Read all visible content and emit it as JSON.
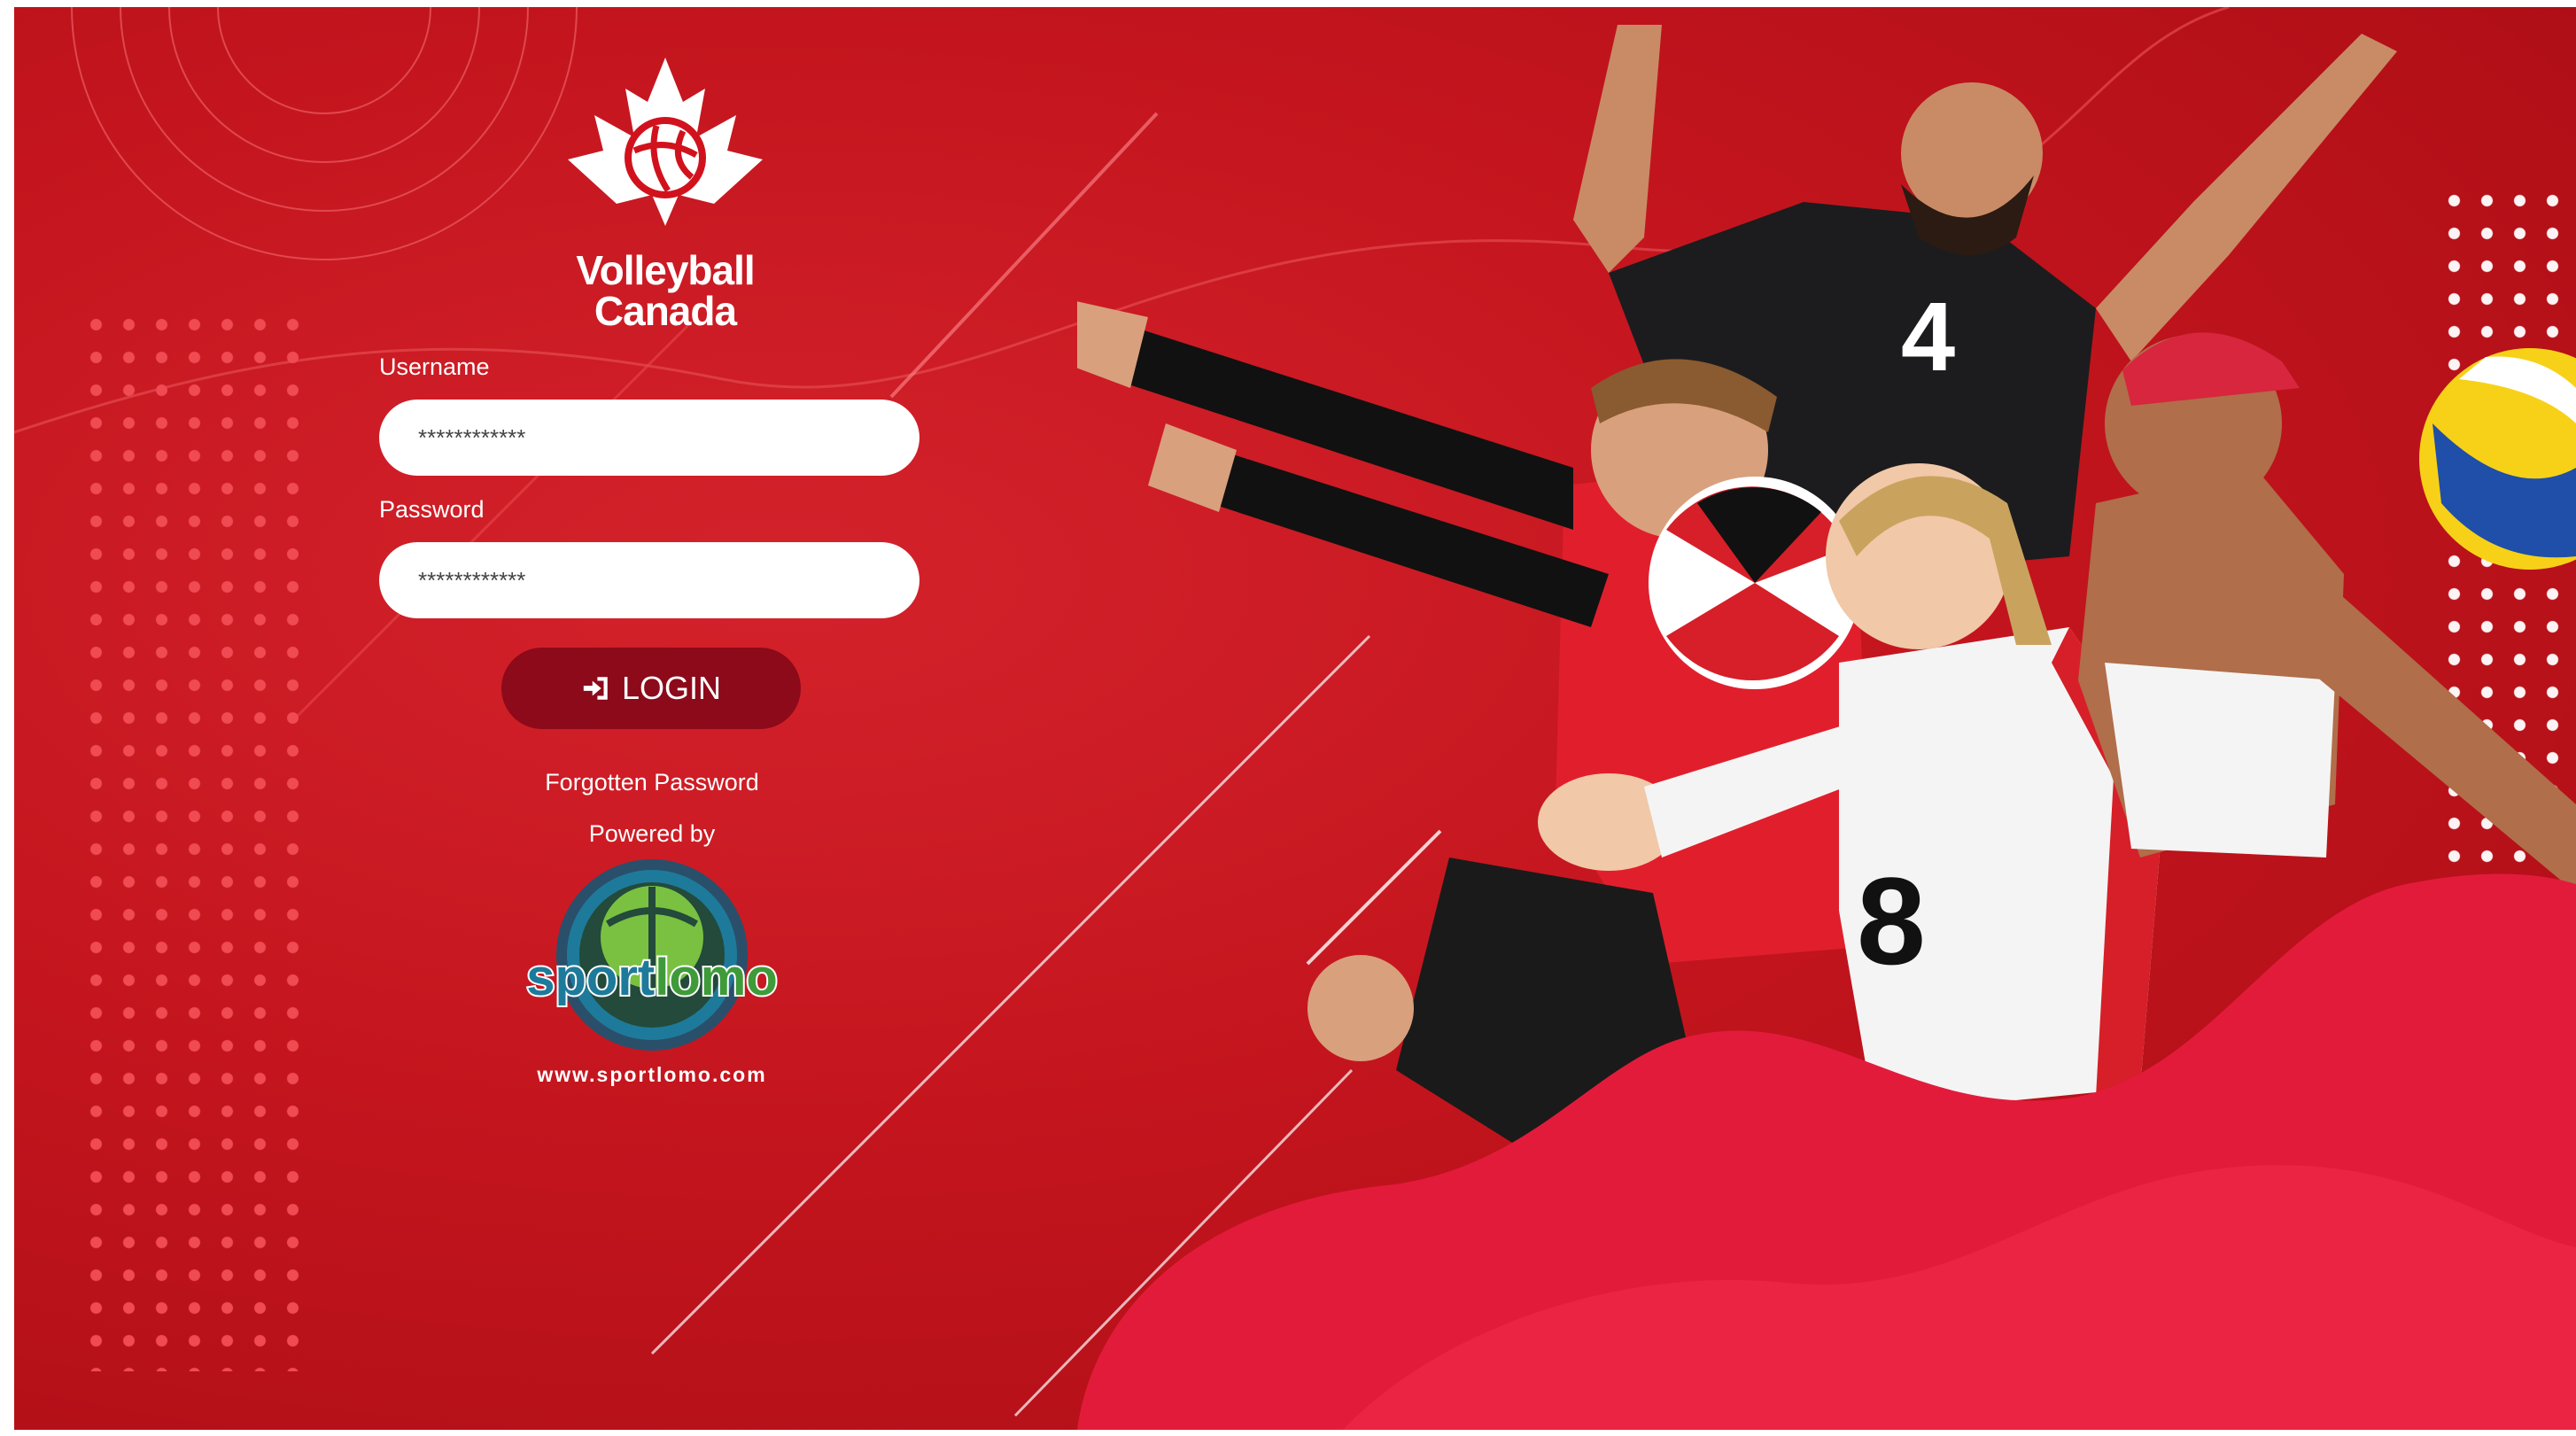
{
  "logo": {
    "line1": "Volleyball",
    "line2": "Canada"
  },
  "form": {
    "username_label": "Username",
    "username_value": "************",
    "password_label": "Password",
    "password_value": "************",
    "login_label": "LOGIN",
    "forgot_label": "Forgotten Password"
  },
  "footer": {
    "powered_by": "Powered by",
    "brand_part1": "sport",
    "brand_part2": "lomo",
    "url": "www.sportlomo.com"
  },
  "hero": {
    "jersey_1": "4",
    "jersey_2": "8"
  },
  "colors": {
    "background": "#c4151e",
    "button": "#8c0a1a",
    "wave": "#e31b3b",
    "text": "#ffffff"
  }
}
